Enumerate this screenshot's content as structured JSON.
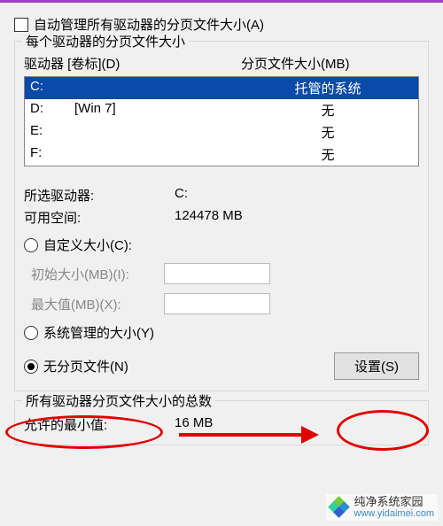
{
  "auto_manage_label": "自动管理所有驱动器的分页文件大小(A)",
  "group1_title": "每个驱动器的分页文件大小",
  "table": {
    "head_drive": "驱动器 [卷标](D)",
    "head_size": "分页文件大小(MB)",
    "rows": [
      {
        "letter": "C:",
        "label": "",
        "pf": "托管的系统",
        "selected": true
      },
      {
        "letter": "D:",
        "label": "[Win 7]",
        "pf": "无",
        "selected": false
      },
      {
        "letter": "E:",
        "label": "",
        "pf": "无",
        "selected": false
      },
      {
        "letter": "F:",
        "label": "",
        "pf": "无",
        "selected": false
      }
    ]
  },
  "selected_drive": {
    "label": "所选驱动器:",
    "value": "C:"
  },
  "free_space": {
    "label": "可用空间:",
    "value": "124478 MB"
  },
  "radio_custom": "自定义大小(C):",
  "initial_size": "初始大小(MB)(I):",
  "max_size": "最大值(MB)(X):",
  "radio_system": "系统管理的大小(Y)",
  "radio_none": "无分页文件(N)",
  "set_btn": "设置(S)",
  "group2_title": "所有驱动器分页文件大小的总数",
  "min_allowed": {
    "label": "允许的最小值:",
    "value": "16 MB"
  },
  "watermark": {
    "line1": "纯净系统家园",
    "line2": "www.yidaimei.com"
  }
}
